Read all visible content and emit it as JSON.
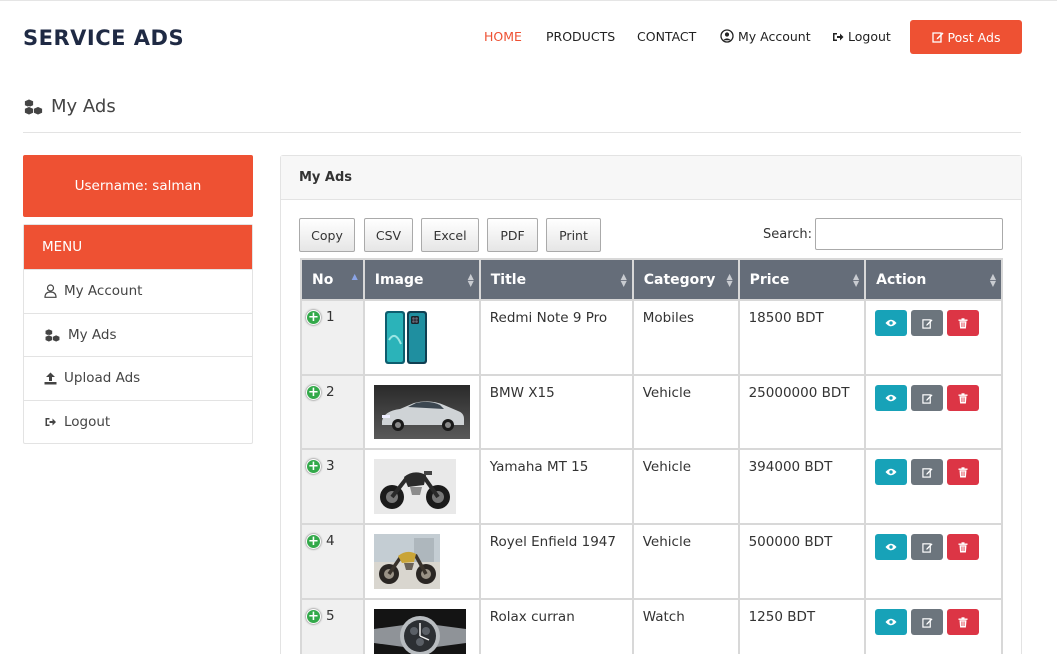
{
  "brand": "SERVICE ADS",
  "nav": {
    "home": "HOME",
    "products": "PRODUCTS",
    "contact": "CONTACT",
    "account": "My Account",
    "logout": "Logout",
    "post": "Post Ads"
  },
  "page_title": "My Ads",
  "sidebar": {
    "username": "Username: salman",
    "menu_title": "MENU",
    "items": [
      {
        "label": "My Account",
        "icon": "user-icon"
      },
      {
        "label": "My Ads",
        "icon": "cubes-icon"
      },
      {
        "label": "Upload Ads",
        "icon": "upload-icon"
      },
      {
        "label": "Logout",
        "icon": "sign-out-icon"
      }
    ]
  },
  "panel": {
    "title": "My Ads",
    "buttons": {
      "copy": "Copy",
      "csv": "CSV",
      "excel": "Excel",
      "pdf": "PDF",
      "print": "Print"
    },
    "search_label": "Search:",
    "search_value": ""
  },
  "table": {
    "columns": [
      "No",
      "Image",
      "Title",
      "Category",
      "Price",
      "Action"
    ],
    "rows": [
      {
        "no": "1",
        "title": "Redmi Note 9 Pro",
        "category": "Mobiles",
        "price": "18500 BDT",
        "image": "phone"
      },
      {
        "no": "2",
        "title": "BMW X15",
        "category": "Vehicle",
        "price": "25000000 BDT",
        "image": "car"
      },
      {
        "no": "3",
        "title": "Yamaha MT 15",
        "category": "Vehicle",
        "price": "394000 BDT",
        "image": "motorbike"
      },
      {
        "no": "4",
        "title": "Royel Enfield 1947",
        "category": "Vehicle",
        "price": "500000 BDT",
        "image": "motorbike-classic"
      },
      {
        "no": "5",
        "title": "Rolax curran",
        "category": "Watch",
        "price": "1250 BDT",
        "image": "watch"
      }
    ]
  },
  "colors": {
    "accent": "#ee5133",
    "table_header": "#656d79",
    "view": "#17a2b8",
    "edit": "#6c757d",
    "delete": "#dc3545"
  }
}
